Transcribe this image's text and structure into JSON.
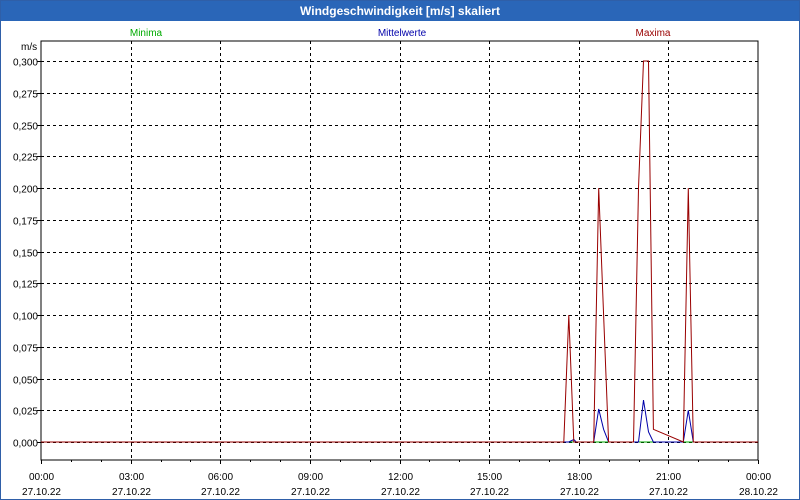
{
  "window": {
    "title": "Windgeschwindigkeit [m/s] skaliert"
  },
  "legend": [
    {
      "name": "Minima",
      "color": "#00aa00"
    },
    {
      "name": "Mittelwerte",
      "color": "#0000aa"
    },
    {
      "name": "Maxima",
      "color": "#990000"
    }
  ],
  "chart_data": {
    "type": "line",
    "title": "Windgeschwindigkeit [m/s] skaliert",
    "ylabel": "m/s",
    "xlabel": "",
    "ylim": [
      0,
      0.3
    ],
    "xlim": [
      "27.10.22 00:00",
      "28.10.22 00:00"
    ],
    "grid": true,
    "legend_position": "top",
    "y_ticks": [
      "0,000",
      "0,025",
      "0,050",
      "0,075",
      "0,100",
      "0,125",
      "0,150",
      "0,175",
      "0,200",
      "0,225",
      "0,250",
      "0,275",
      "0,300"
    ],
    "x_ticks": [
      {
        "time": "00:00",
        "date": "27.10.22"
      },
      {
        "time": "03:00",
        "date": "27.10.22"
      },
      {
        "time": "06:00",
        "date": "27.10.22"
      },
      {
        "time": "09:00",
        "date": "27.10.22"
      },
      {
        "time": "12:00",
        "date": "27.10.22"
      },
      {
        "time": "15:00",
        "date": "27.10.22"
      },
      {
        "time": "18:00",
        "date": "27.10.22"
      },
      {
        "time": "21:00",
        "date": "27.10.22"
      },
      {
        "time": "00:00",
        "date": "28.10.22"
      }
    ],
    "series": [
      {
        "name": "Minima",
        "color": "#00aa00",
        "points": [
          [
            "27.10.22 00:00",
            0
          ],
          [
            "28.10.22 00:00",
            0
          ]
        ]
      },
      {
        "name": "Mittelwerte",
        "color": "#0000aa",
        "points": [
          [
            "27.10.22 00:00",
            0
          ],
          [
            "27.10.22 17:40",
            0
          ],
          [
            "27.10.22 17:50",
            0.002
          ],
          [
            "27.10.22 17:55",
            0
          ],
          [
            "27.10.22 18:30",
            0
          ],
          [
            "27.10.22 18:40",
            0.026
          ],
          [
            "27.10.22 18:50",
            0.01
          ],
          [
            "27.10.22 19:00",
            0
          ],
          [
            "27.10.22 20:00",
            0
          ],
          [
            "27.10.22 20:10",
            0.033
          ],
          [
            "27.10.22 20:20",
            0.008
          ],
          [
            "27.10.22 20:30",
            0
          ],
          [
            "27.10.22 21:30",
            0
          ],
          [
            "27.10.22 21:40",
            0.025
          ],
          [
            "27.10.22 21:50",
            0
          ],
          [
            "28.10.22 00:00",
            0
          ]
        ]
      },
      {
        "name": "Maxima",
        "color": "#990000",
        "points": [
          [
            "27.10.22 00:00",
            0
          ],
          [
            "27.10.22 17:30",
            0
          ],
          [
            "27.10.22 17:40",
            0.1
          ],
          [
            "27.10.22 17:50",
            0
          ],
          [
            "27.10.22 18:30",
            0
          ],
          [
            "27.10.22 18:40",
            0.2
          ],
          [
            "27.10.22 18:50",
            0.1
          ],
          [
            "27.10.22 19:00",
            0
          ],
          [
            "27.10.22 19:50",
            0
          ],
          [
            "27.10.22 20:00",
            0.2
          ],
          [
            "27.10.22 20:10",
            0.3
          ],
          [
            "27.10.22 20:20",
            0.3
          ],
          [
            "27.10.22 20:30",
            0.01
          ],
          [
            "27.10.22 21:30",
            0
          ],
          [
            "27.10.22 21:40",
            0.2
          ],
          [
            "27.10.22 21:50",
            0
          ],
          [
            "28.10.22 00:00",
            0
          ]
        ]
      }
    ]
  }
}
